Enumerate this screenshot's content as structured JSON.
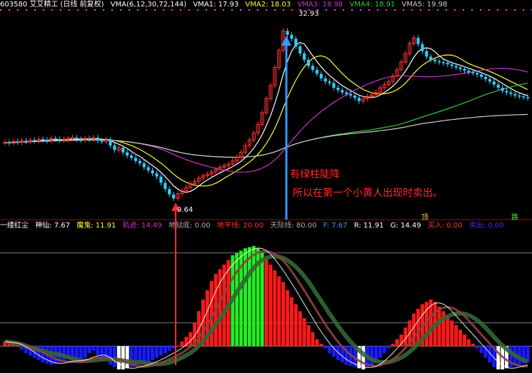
{
  "header_top": {
    "stock": "603580 艾艾精工 (日线 前复权)",
    "indicator": "VMA(6,12,30,72,144)",
    "vma1": "VMA1: 17.93",
    "vma2": "VMA2: 18.03",
    "vma3": "VMA3: 18.98",
    "vma4": "VMA4: 18.91",
    "vma5": "VMA5: 19.98"
  },
  "header_bottom": {
    "name": "一缕红尘",
    "shenxian": "神仙: 7.67",
    "mogui": "魔鬼: 11.91",
    "guiji": "轨迹: 14.49",
    "diyudi": "地狱底: 0.00",
    "dipingxian": "地平线: 20.00",
    "tianjixian": "天际线: 80.00",
    "f": "F: 7.67",
    "r": "R: 11.91",
    "g": "G: 14.49",
    "mairu": "买入: 0.00",
    "maichu": "卖出: 0.00"
  },
  "annotations": {
    "line1": "有绿柱陡降",
    "line2": "所以在第一个小黄人出现时卖出。",
    "high": "32.93",
    "low": "9.64",
    "sell_tag": "顶",
    "buy_tag": "跌"
  },
  "colors": {
    "up": "#ff3333",
    "down": "#33ccff",
    "vma1": "#ffffff",
    "vma2": "#ffff33",
    "vma3": "#cc33cc",
    "vma4": "#33cc33",
    "vma5": "#cccccc",
    "bar_red": "#ff1a1a",
    "bar_blue": "#1a1aff",
    "bar_green": "#22ee22"
  },
  "chart_data": {
    "type": "line",
    "title": "",
    "subtitle": "",
    "ylim": [
      8,
      34
    ],
    "x": [
      0,
      1,
      2,
      3,
      4,
      5,
      6,
      7,
      8,
      9,
      10,
      11,
      12,
      13,
      14,
      15,
      16,
      17,
      18,
      19,
      20,
      21,
      22,
      23,
      24,
      25,
      26,
      27,
      28,
      29,
      30,
      31,
      32,
      33,
      34,
      35,
      36,
      37,
      38,
      39,
      40,
      41,
      42,
      43,
      44,
      45,
      46,
      47,
      48,
      49,
      50,
      51,
      52,
      53,
      54,
      55,
      56,
      57,
      58,
      59,
      60,
      61,
      62,
      63,
      64,
      65,
      66,
      67,
      68,
      69,
      70,
      71,
      72,
      73,
      74,
      75,
      76,
      77,
      78,
      79,
      80,
      81,
      82,
      83,
      84,
      85,
      86,
      87,
      88,
      89,
      90,
      91,
      92,
      93,
      94,
      95,
      96,
      97,
      98,
      99,
      100,
      101,
      102,
      103,
      104,
      105,
      106,
      107,
      108,
      109,
      110,
      111,
      112,
      113,
      114,
      115,
      116,
      117,
      118,
      119,
      120,
      121,
      122,
      123,
      124
    ],
    "close": [
      17.2,
      17.1,
      17.3,
      17.2,
      17.4,
      17.3,
      17.5,
      17.4,
      17.6,
      17.5,
      17.4,
      17.7,
      17.6,
      17.5,
      17.6,
      17.7,
      17.8,
      17.6,
      17.5,
      17.7,
      17.6,
      17.8,
      17.4,
      17.3,
      17.5,
      16.8,
      16.2,
      16.5,
      15.9,
      15.5,
      15.2,
      14.8,
      14.5,
      14.0,
      13.6,
      13.2,
      12.8,
      12.0,
      11.2,
      10.5,
      10.0,
      10.6,
      11.0,
      11.4,
      11.9,
      12.2,
      12.6,
      12.9,
      13.1,
      13.4,
      13.7,
      14.0,
      14.2,
      14.4,
      14.8,
      15.3,
      15.9,
      16.8,
      17.5,
      18.4,
      19.5,
      21.0,
      22.8,
      24.5,
      26.8,
      29.0,
      31.5,
      31.0,
      30.5,
      29.5,
      28.6,
      27.8,
      27.0,
      26.5,
      26.0,
      25.4,
      25.0,
      24.8,
      24.2,
      23.9,
      23.6,
      23.4,
      23.2,
      22.9,
      22.5,
      22.8,
      23.1,
      23.3,
      23.6,
      24.2,
      24.6,
      25.0,
      25.7,
      26.5,
      27.5,
      28.6,
      29.9,
      30.6,
      29.8,
      28.9,
      28.2,
      27.8,
      27.6,
      27.5,
      27.4,
      27.2,
      27.0,
      26.8,
      26.6,
      26.4,
      26.2,
      26.1,
      25.9,
      25.6,
      25.3,
      25.0,
      24.6,
      24.2,
      23.8,
      23.6,
      23.4,
      23.2,
      23.1,
      23.0,
      22.9
    ],
    "series": [
      {
        "name": "VMA1",
        "values": []
      },
      {
        "name": "VMA2",
        "values": []
      },
      {
        "name": "VMA3",
        "values": []
      },
      {
        "name": "VMA4",
        "values": []
      },
      {
        "name": "VMA5",
        "values": []
      }
    ],
    "indicator": {
      "type": "bar",
      "ylim": [
        -20,
        100
      ],
      "reference_lines": [
        0,
        20,
        80
      ],
      "values": [
        4,
        3,
        2,
        1,
        -3,
        -6,
        -8,
        -10,
        -12,
        -14,
        -15,
        -16,
        -15,
        -14,
        -13,
        -11,
        -12,
        -13,
        -14,
        -10,
        -6,
        -4,
        -8,
        -10,
        -12,
        -16,
        -18,
        -20,
        -20,
        -19,
        -18,
        -17,
        -16,
        -15,
        -14,
        -12,
        -10,
        -8,
        -6,
        -4,
        -2,
        0,
        4,
        8,
        12,
        20,
        30,
        40,
        48,
        56,
        62,
        66,
        70,
        74,
        78,
        80,
        82,
        84,
        85,
        86,
        84,
        80,
        75,
        70,
        65,
        60,
        55,
        48,
        42,
        36,
        30,
        24,
        18,
        12,
        6,
        2,
        -2,
        -6,
        -9,
        -12,
        -14,
        -16,
        -17,
        -18,
        -19,
        -20,
        -18,
        -16,
        -14,
        -10,
        -6,
        -2,
        2,
        6,
        10,
        16,
        22,
        28,
        32,
        36,
        38,
        40,
        38,
        34,
        30,
        26,
        22,
        18,
        14,
        10,
        6,
        2,
        -2,
        -6,
        -10,
        -14,
        -18,
        -20,
        -20,
        -19,
        -18,
        -17,
        -16,
        -15,
        -14
      ]
    }
  }
}
